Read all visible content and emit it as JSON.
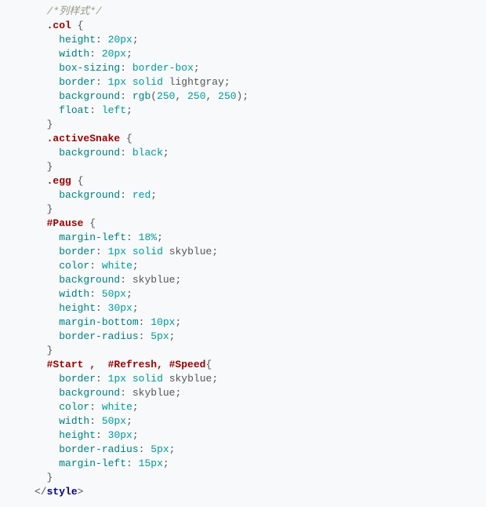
{
  "code": {
    "l01_comment": "/*列样式*/",
    "sel_col": ".col",
    "sel_activeSnake": ".activeSnake",
    "sel_egg": ".egg",
    "sel_Pause": "#Pause",
    "sel_buttons": "#Start ,  #Refresh, #Speed",
    "prop": {
      "height": "height",
      "width": "width",
      "box_sizing": "box-sizing",
      "border": "border",
      "background": "background",
      "float": "float",
      "margin_left": "margin-left",
      "color": "color",
      "margin_bottom": "margin-bottom",
      "border_radius": "border-radius"
    },
    "val": {
      "_20px": "20px",
      "border_box": "border-box",
      "_1px": "1px",
      "solid": "solid",
      "lightgray": "lightgray",
      "rgb": "rgb",
      "_250": "250",
      "left": "left",
      "black": "black",
      "red": "red",
      "_18pct": "18%",
      "skyblue": "skyblue",
      "white": "white",
      "_50px": "50px",
      "_30px": "30px",
      "_10px": "10px",
      "_5px": "5px",
      "_15px": "15px"
    },
    "brace_open": "{",
    "brace_close": "}",
    "semi": ";",
    "comma": ",",
    "lparen": "(",
    "rparen": ")",
    "tag_open": "</",
    "tag_name": "style",
    "tag_close": ">"
  }
}
